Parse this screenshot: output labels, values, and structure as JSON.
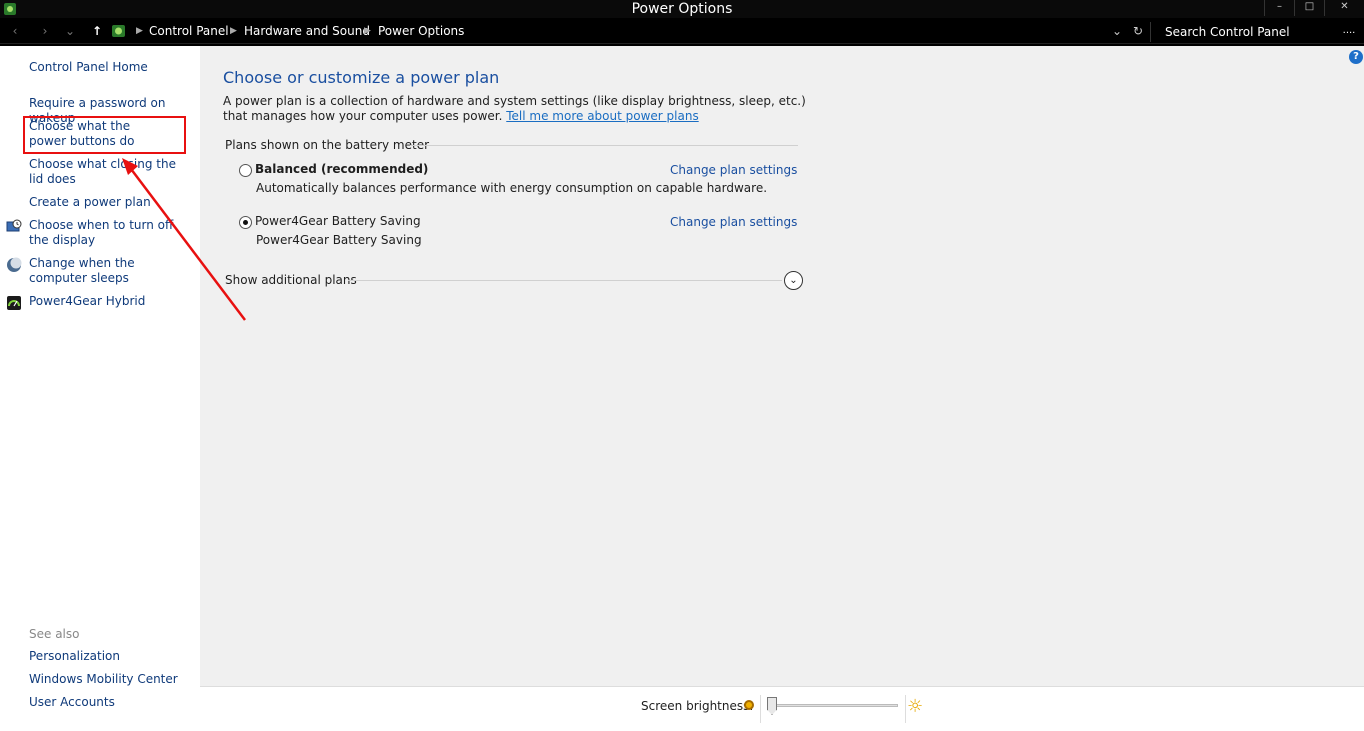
{
  "window": {
    "title": "Power Options",
    "minimize_glyph": "–",
    "maximize_glyph": "□",
    "close_glyph": "✕"
  },
  "nav": {
    "back_glyph": "‹",
    "forward_glyph": "›",
    "recent_glyph": "⌄",
    "up_glyph": "↑",
    "breadcrumbs": [
      "Control Panel",
      "Hardware and Sound",
      "Power Options"
    ],
    "breadcrumb_sep": "▶",
    "dropdown_glyph": "⌄",
    "refresh_glyph": "↻",
    "search_placeholder": "Search Control Panel",
    "more_glyph": "...."
  },
  "sidebar": {
    "home": "Control Panel Home",
    "items": [
      {
        "label": "Require a password on wakeup",
        "icon": "none"
      },
      {
        "label": "Choose what the power buttons do",
        "icon": "none"
      },
      {
        "label": "Choose what closing the lid does",
        "icon": "none"
      },
      {
        "label": "Create a power plan",
        "icon": "none"
      },
      {
        "label": "Choose when to turn off the display",
        "icon": "clock-monitor-icon"
      },
      {
        "label": "Change when the computer sleeps",
        "icon": "moon-icon"
      },
      {
        "label": "Power4Gear Hybrid",
        "icon": "gauge-icon"
      }
    ],
    "see_also_label": "See also",
    "see_also": [
      "Personalization",
      "Windows Mobility Center",
      "User Accounts"
    ]
  },
  "main": {
    "help_glyph": "?",
    "heading": "Choose or customize a power plan",
    "description_text": "A power plan is a collection of hardware and system settings (like display brightness, sleep, etc.) that manages how your computer uses power.",
    "learn_more_link": "Tell me more about power plans",
    "group_label": "Plans shown on the battery meter",
    "plans": [
      {
        "name": "Balanced (recommended)",
        "description": "Automatically balances performance with energy consumption on capable hardware.",
        "selected": false,
        "change_link": "Change plan settings"
      },
      {
        "name": "Power4Gear Battery Saving",
        "description": "Power4Gear Battery Saving",
        "selected": true,
        "change_link": "Change plan settings"
      }
    ],
    "show_additional_plans": "Show additional plans",
    "expand_glyph": "⌄"
  },
  "footer": {
    "brightness_label": "Screen brightness:",
    "brightness_level": 0,
    "sun_glyph": "☼"
  },
  "colors": {
    "link": "#0f3a7a",
    "heading": "#1a4fa0",
    "annotation": "#e81010"
  }
}
